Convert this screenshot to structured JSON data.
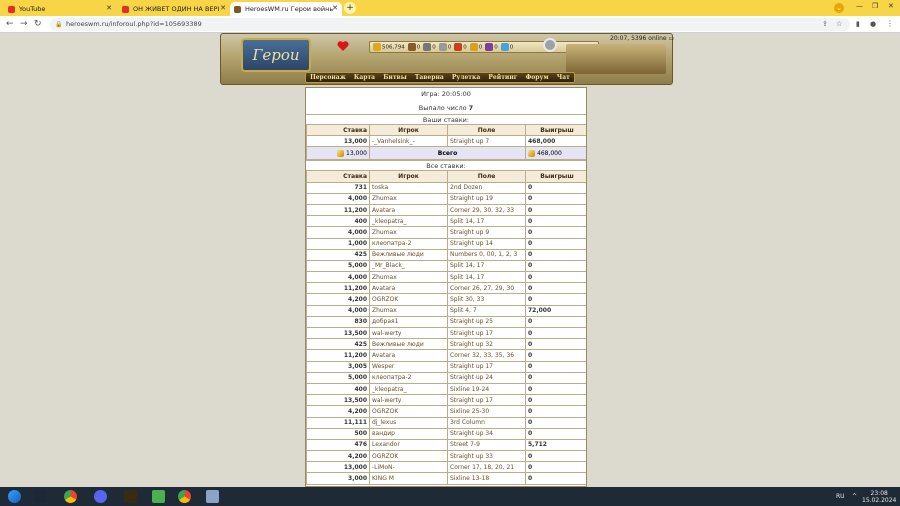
{
  "browser": {
    "tabs": [
      {
        "title": "YouTube",
        "icon_color": "#e52d27",
        "active": false
      },
      {
        "title": "ОН ЖИВЕТ ОДИН НА ВЕРШИНЕ",
        "icon_color": "#e52d27",
        "active": false
      },
      {
        "title": "HeroesWM.ru Герои войны и д",
        "icon_color": "#7a5a20",
        "active": true
      }
    ],
    "new_tab": "+",
    "url": "heroeswm.ru/inforoul.php?id=105693389",
    "profile_initial": "v"
  },
  "header": {
    "logo_text": "Герои",
    "resources": [
      {
        "name": "gold",
        "value": "506,794",
        "icon_color": "#e0a820"
      },
      {
        "name": "wood",
        "value": "0",
        "icon_color": "#8c5a2a"
      },
      {
        "name": "ore",
        "value": "0",
        "icon_color": "#777777"
      },
      {
        "name": "mercury",
        "value": "0",
        "icon_color": "#999999"
      },
      {
        "name": "sulfur",
        "value": "0",
        "icon_color": "#c84020"
      },
      {
        "name": "crystal",
        "value": "0",
        "icon_color": "#d9a020"
      },
      {
        "name": "gems",
        "value": "0",
        "icon_color": "#7a40a0"
      },
      {
        "name": "diamonds",
        "value": "0",
        "icon_color": "#4aa0e0"
      }
    ],
    "online": "20:07, 5396 online",
    "nav": [
      "Персонаж",
      "Карта",
      "Битвы",
      "Таверна",
      "Рулетка",
      "Рейтинг",
      "Форум",
      "Чат"
    ]
  },
  "game": {
    "game_line": "Игра: 20:05:00",
    "result_label": "Выпало число",
    "result_number": "7",
    "your_bets_title": "Ваши ставки:",
    "all_bets_title": "Все ставки:",
    "headers": {
      "stake": "Ставка",
      "player": "Игрок",
      "field": "Поле",
      "win": "Выигрыш"
    },
    "your_bets": [
      {
        "stake": "13,000",
        "player": "-_Vanhelsink_-",
        "field": "Straight up 7",
        "win": "468,000"
      }
    ],
    "total": {
      "stake": "13,000",
      "label": "Всего",
      "win": "468,000"
    },
    "all_bets": [
      {
        "stake": "731",
        "player": "toska",
        "field": "2nd Dozen",
        "win": "0"
      },
      {
        "stake": "4,000",
        "player": "Zhumax",
        "field": "Straight up 19",
        "win": "0"
      },
      {
        "stake": "11,200",
        "player": "Avatara",
        "field": "Corner 29, 30, 32, 33",
        "win": "0"
      },
      {
        "stake": "400",
        "player": "_kleopatra_",
        "field": "Split 14, 17",
        "win": "0"
      },
      {
        "stake": "4,000",
        "player": "Zhumax",
        "field": "Straight up 9",
        "win": "0"
      },
      {
        "stake": "1,000",
        "player": "клеопатра-2",
        "field": "Straight up 14",
        "win": "0"
      },
      {
        "stake": "425",
        "player": "Вежливые люди",
        "field": "Numbers 0, 00, 1, 2, 3",
        "win": "0"
      },
      {
        "stake": "5,000",
        "player": "_Mr_Black_",
        "field": "Split 14, 17",
        "win": "0"
      },
      {
        "stake": "4,000",
        "player": "Zhumax",
        "field": "Split 14, 17",
        "win": "0"
      },
      {
        "stake": "11,200",
        "player": "Avatara",
        "field": "Corner 26, 27, 29, 30",
        "win": "0"
      },
      {
        "stake": "4,200",
        "player": "OGRZOK",
        "field": "Split 30, 33",
        "win": "0"
      },
      {
        "stake": "4,000",
        "player": "Zhumax",
        "field": "Split 4, 7",
        "win": "72,000"
      },
      {
        "stake": "830",
        "player": "добрая1",
        "field": "Straight up 25",
        "win": "0"
      },
      {
        "stake": "13,500",
        "player": "wal-werty",
        "field": "Straight up 17",
        "win": "0"
      },
      {
        "stake": "425",
        "player": "Вежливые люди",
        "field": "Straight up 32",
        "win": "0"
      },
      {
        "stake": "11,200",
        "player": "Avatara",
        "field": "Corner 32, 33, 35, 36",
        "win": "0"
      },
      {
        "stake": "3,005",
        "player": "Wesper",
        "field": "Straight up 17",
        "win": "0"
      },
      {
        "stake": "5,000",
        "player": "клеопатра-2",
        "field": "Straight up 24",
        "win": "0"
      },
      {
        "stake": "400",
        "player": "_kleopatra_",
        "field": "Sixline 19-24",
        "win": "0"
      },
      {
        "stake": "13,500",
        "player": "wal-werty",
        "field": "Straight up 17",
        "win": "0"
      },
      {
        "stake": "4,200",
        "player": "OGRZOK",
        "field": "Sixline 25-30",
        "win": "0"
      },
      {
        "stake": "11,111",
        "player": "dj_lexus",
        "field": "3rd Column",
        "win": "0"
      },
      {
        "stake": "500",
        "player": "вандир",
        "field": "Straight up 34",
        "win": "0"
      },
      {
        "stake": "476",
        "player": "Lexandor",
        "field": "Street 7-9",
        "win": "5,712"
      },
      {
        "stake": "4,200",
        "player": "OGRZOK",
        "field": "Straight up 33",
        "win": "0"
      },
      {
        "stake": "13,000",
        "player": "-LiMoN-",
        "field": "Corner 17, 18, 20, 21",
        "win": "0"
      },
      {
        "stake": "3,000",
        "player": "KING M",
        "field": "Sixline 13-18",
        "win": "0"
      }
    ]
  },
  "taskbar": {
    "lang": "RU",
    "time": "23:08",
    "date": "15.02.2024"
  }
}
